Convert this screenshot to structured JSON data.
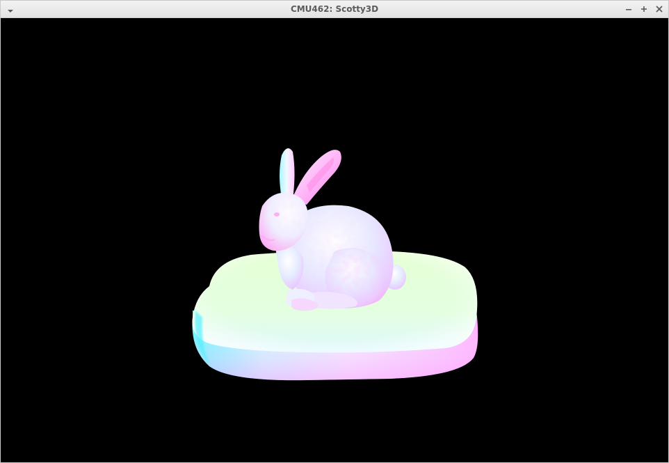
{
  "window": {
    "title": "CMU462: Scotty3D"
  },
  "titlebar_icons": {
    "menu": "chevron-down-icon",
    "minimize": "minimize-icon",
    "maximize": "maximize-icon",
    "close": "close-icon"
  },
  "scene": {
    "background_color": "#000000",
    "shading": "normal-map",
    "objects": [
      "bunny",
      "pedestal"
    ]
  }
}
